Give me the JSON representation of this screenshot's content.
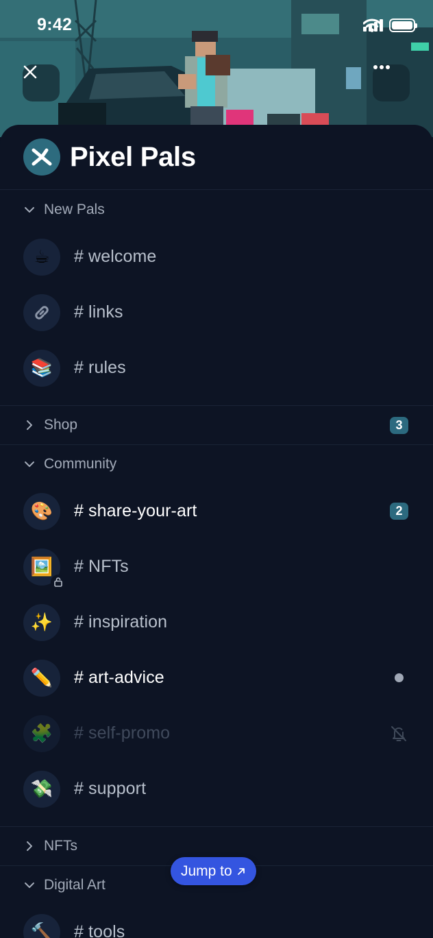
{
  "status_bar": {
    "time": "9:42"
  },
  "hero": {
    "close_icon": "close-icon",
    "more_icon": "more-horizontal-icon"
  },
  "server": {
    "name": "Pixel Pals",
    "logo_icon": "x-logo-icon",
    "accent": "#2d6b7e"
  },
  "categories": [
    {
      "label": "New Pals",
      "expanded": true,
      "channels": [
        {
          "name": "# welcome",
          "emoji": "☕",
          "icon": "coffee-icon"
        },
        {
          "name": "# links",
          "emoji": "🔗",
          "icon": "link-icon"
        },
        {
          "name": "# rules",
          "emoji": "📚",
          "icon": "books-icon"
        }
      ]
    },
    {
      "label": "Shop",
      "expanded": false,
      "badge": "3"
    },
    {
      "label": "Community",
      "expanded": true,
      "channels": [
        {
          "name": "# share-your-art",
          "emoji": "🎨",
          "icon": "palette-icon",
          "badge": "2"
        },
        {
          "name": "# NFTs",
          "emoji": "🖼️",
          "icon": "framed-picture-icon",
          "locked": true
        },
        {
          "name": "# inspiration",
          "emoji": "✨",
          "icon": "sparkles-icon"
        },
        {
          "name": "# art-advice",
          "emoji": "✏️",
          "icon": "pencil-icon",
          "unread": true
        },
        {
          "name": "# self-promo",
          "emoji": "🧩",
          "icon": "puzzle-icon",
          "muted": true
        },
        {
          "name": "# support",
          "emoji": "💸",
          "icon": "money-wings-icon"
        }
      ]
    },
    {
      "label": "NFTs",
      "expanded": false,
      "unread": true
    },
    {
      "label": "Digital Art",
      "expanded": true,
      "channels": [
        {
          "name": "# tools",
          "emoji": "🔨",
          "icon": "hammer-icon"
        }
      ]
    }
  ],
  "jump_to": {
    "label": "Jump to",
    "icon": "arrow-up-right-icon"
  },
  "colors": {
    "background": "#0d1424",
    "badge": "#2c6a7f",
    "jump_button": "#3455e0"
  }
}
